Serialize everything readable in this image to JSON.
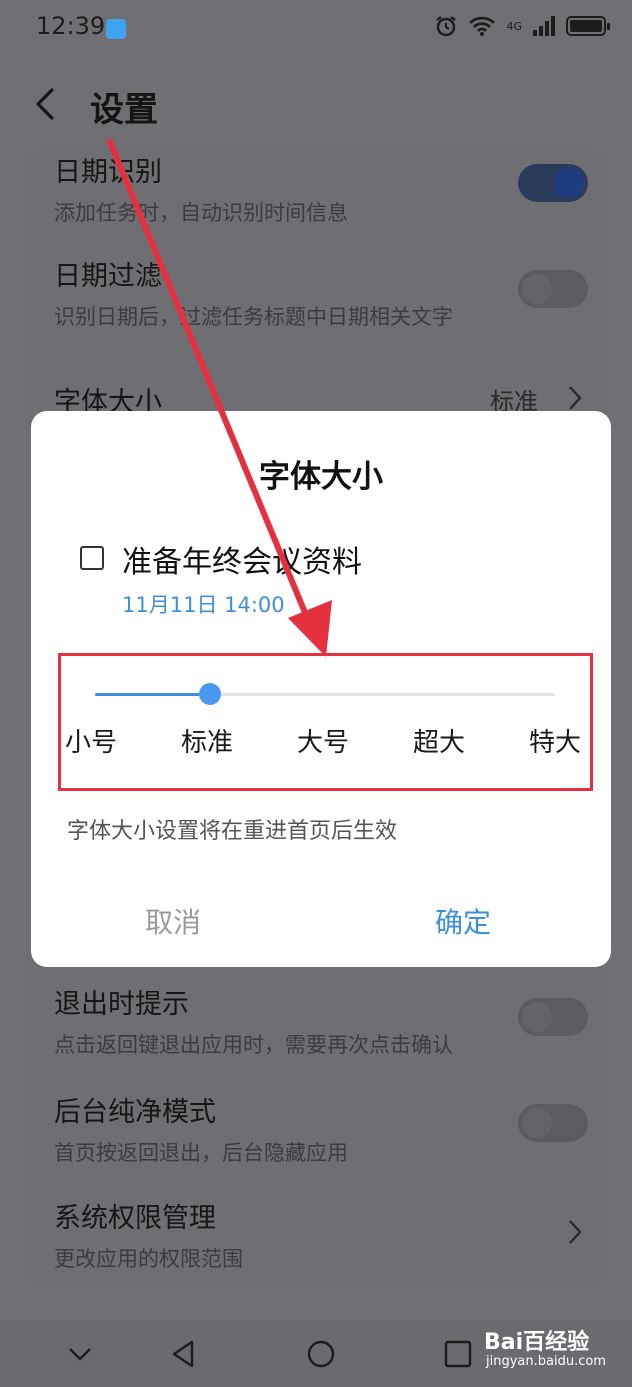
{
  "status_bar": {
    "time": "12:39",
    "network": "4G"
  },
  "header": {
    "title": "设置"
  },
  "settings": {
    "date_recognition": {
      "title": "日期识别",
      "subtitle": "添加任务时，自动识别时间信息",
      "enabled": true
    },
    "date_filter": {
      "title": "日期过滤",
      "subtitle": "识别日期后，过滤任务标题中日期相关文字",
      "enabled": false
    },
    "font_size": {
      "title": "字体大小",
      "value": "标准"
    },
    "exit_prompt": {
      "title": "退出时提示",
      "subtitle": "点击返回键退出应用时，需要再次点击确认",
      "enabled": false
    },
    "background_pure": {
      "title": "后台纯净模式",
      "subtitle": "首页按返回退出，后台隐藏应用",
      "enabled": false
    },
    "system_permissions": {
      "title": "系统权限管理",
      "subtitle": "更改应用的权限范围"
    }
  },
  "dialog": {
    "title": "字体大小",
    "preview_task": {
      "title": "准备年终会议资料",
      "date": "11月11日 14:00",
      "checked": false
    },
    "slider": {
      "options": [
        "小号",
        "标准",
        "大号",
        "超大",
        "特大"
      ],
      "selected_index": 1
    },
    "note": "字体大小设置将在重进首页后生效",
    "cancel_label": "取消",
    "confirm_label": "确定"
  },
  "watermark": {
    "main": "Bai百经验",
    "sub": "jingyan.baidu.com"
  },
  "colors": {
    "accent": "#3d8fdc",
    "highlight": "#e53040",
    "arrow": "#e53040",
    "dim_overlay": "#707074"
  }
}
